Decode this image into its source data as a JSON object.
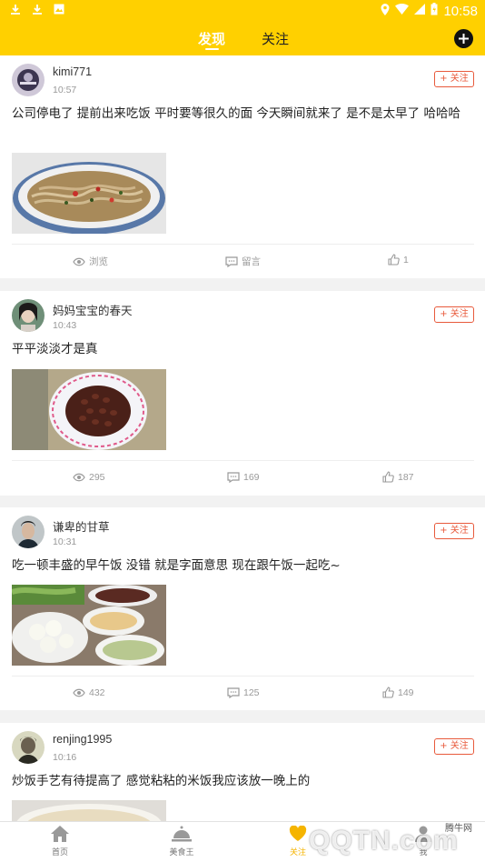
{
  "status_bar": {
    "time": "10:58"
  },
  "header": {
    "tabs": [
      {
        "label": "发现",
        "active": true
      },
      {
        "label": "关注",
        "active": false
      }
    ]
  },
  "posts": [
    {
      "username": "kimi771",
      "time": "10:57",
      "follow_label": "+ 关注",
      "content": "公司停电了 提前出来吃饭 平时要等很久的面 今天瞬间就来了 是不是太早了 哈哈哈",
      "views": "浏览",
      "comments": "留言",
      "likes": "1"
    },
    {
      "username": "妈妈宝宝的春天",
      "time": "10:43",
      "follow_label": "+ 关注",
      "content": "平平淡淡才是真",
      "views": "295",
      "comments": "169",
      "likes": "187"
    },
    {
      "username": "谦卑的甘草",
      "time": "10:31",
      "follow_label": "+ 关注",
      "content": "吃一顿丰盛的早午饭 没错 就是字面意思 现在跟午饭一起吃~",
      "views": "432",
      "comments": "125",
      "likes": "149"
    },
    {
      "username": "renjing1995",
      "time": "10:16",
      "follow_label": "+ 关注",
      "content": "炒饭手艺有待提高了 感觉粘粘的米饭我应该放一晚上的"
    }
  ],
  "bottom_nav": [
    {
      "label": "首页",
      "icon": "home-icon"
    },
    {
      "label": "美食王",
      "icon": "cloche-icon"
    },
    {
      "label": "关注",
      "icon": "follow-icon",
      "active": true
    },
    {
      "label": "我",
      "icon": "user-icon"
    }
  ],
  "watermark": {
    "logo": "QQTN.com",
    "sub": "腾牛网"
  },
  "colors": {
    "brand_yellow": "#ffd000",
    "follow_red": "#e85a3c",
    "active_nav": "#f5b400"
  }
}
